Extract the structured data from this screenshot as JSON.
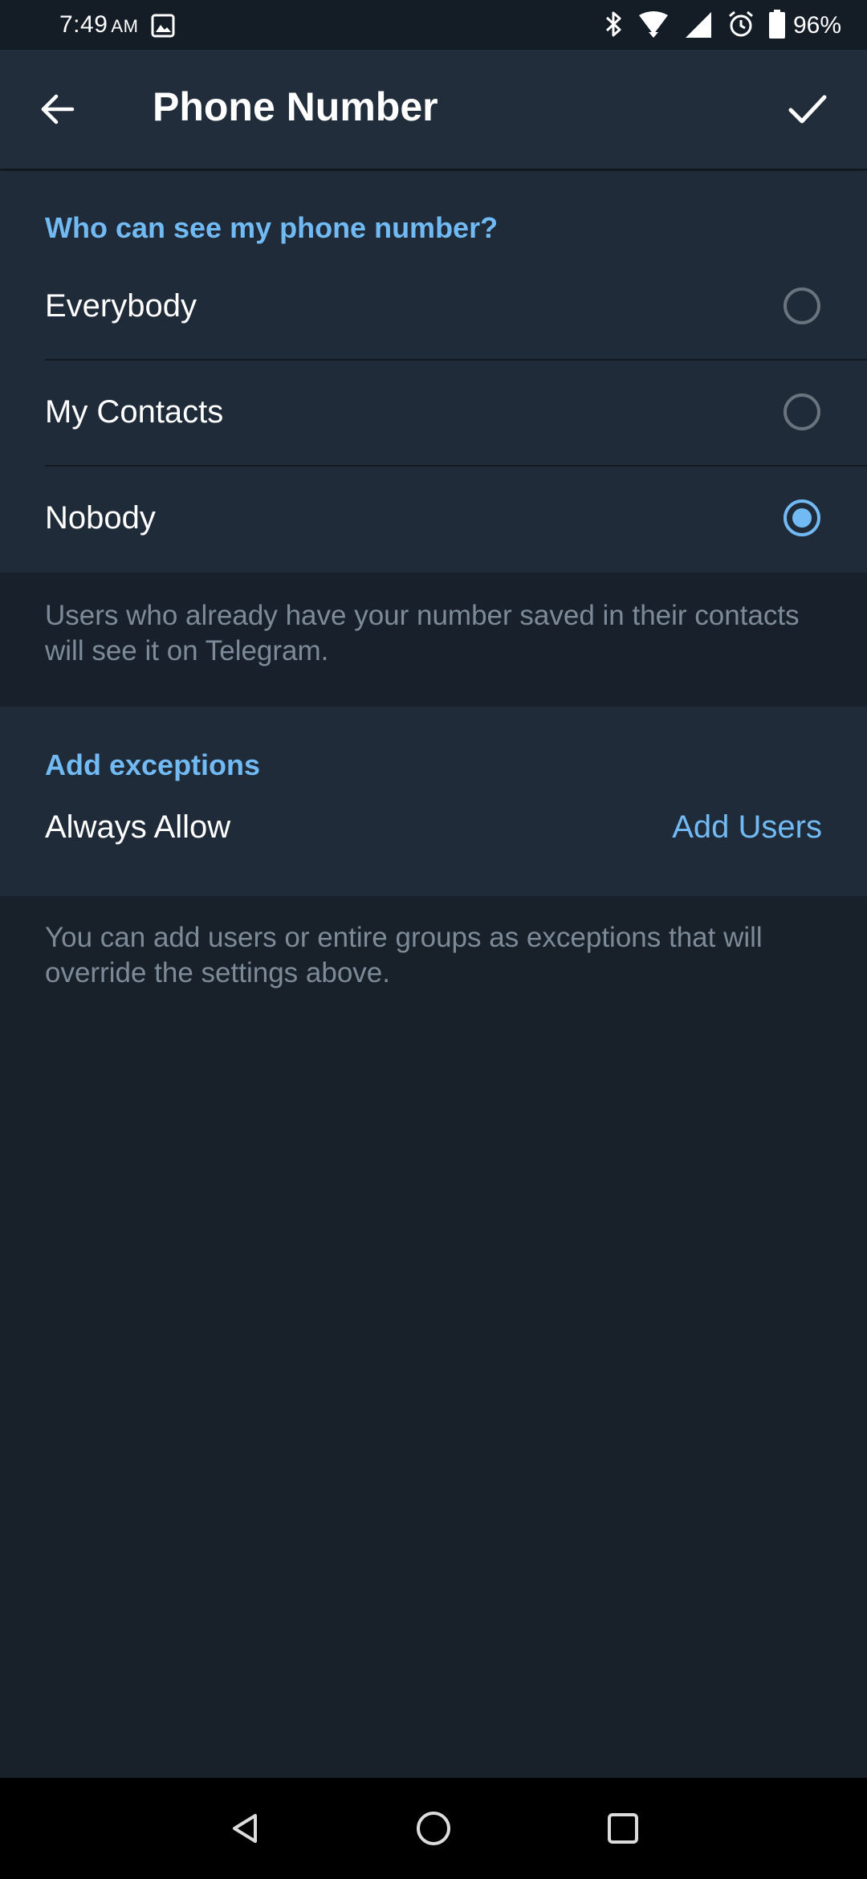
{
  "status_bar": {
    "time": "7:49",
    "ampm": "AM",
    "battery": "96%"
  },
  "app_bar": {
    "title": "Phone Number"
  },
  "privacy": {
    "header": "Who can see my phone number?",
    "options": [
      {
        "label": "Everybody",
        "selected": false
      },
      {
        "label": "My Contacts",
        "selected": false
      },
      {
        "label": "Nobody",
        "selected": true
      }
    ],
    "info": "Users who already have your number saved in their contacts will see it on Telegram."
  },
  "exceptions": {
    "header": "Add exceptions",
    "always_allow_label": "Always Allow",
    "add_users_label": "Add Users",
    "info": "You can add users or entire groups as exceptions that will override the settings above."
  },
  "colors": {
    "accent": "#71baf4",
    "background": "#18202a",
    "section": "#202b39",
    "app_bar": "#212d3b"
  },
  "icons": {
    "back": "arrow-left-icon",
    "done": "check-icon",
    "nav_back": "triangle-back-icon",
    "nav_home": "circle-home-icon",
    "nav_recents": "square-recents-icon"
  }
}
